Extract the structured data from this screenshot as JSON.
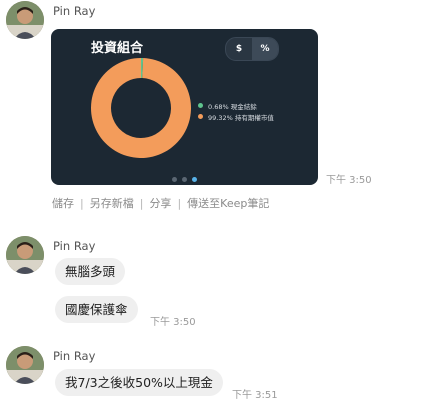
{
  "messages": [
    {
      "sender": "Pin Ray"
    },
    {
      "sender": "Pin Ray"
    },
    {
      "sender": "Pin Ray"
    }
  ],
  "card": {
    "title": "投資組合",
    "toggle": {
      "left": "$",
      "right": "%",
      "selected": "%"
    },
    "legend": [
      {
        "label": "0.68%  現金結餘",
        "color": "#5fc48e"
      },
      {
        "label": "99.32%  持有期權市值",
        "color": "#f39c5b"
      }
    ],
    "pager_active": 3,
    "time": "下午 3:50"
  },
  "chart_data": {
    "type": "pie",
    "donut": true,
    "categories": [
      "現金結餘",
      "持有期權市值"
    ],
    "values": [
      0.68,
      99.32
    ],
    "colors": [
      "#5fc48e",
      "#f39c5b"
    ]
  },
  "actions": [
    "儲存",
    "另存新檔",
    "分享",
    "傳送至Keep筆記"
  ],
  "bubbles": {
    "b1": "無腦多頭",
    "b2": "國慶保護傘",
    "b2_time": "下午 3:50",
    "b3": "我7/3之後收50%以上現金",
    "b3_time": "下午 3:51"
  },
  "colors": {
    "card_bg": "#1c2833",
    "bubble_bg": "#efefef",
    "pager_active": "#58b2e8"
  }
}
